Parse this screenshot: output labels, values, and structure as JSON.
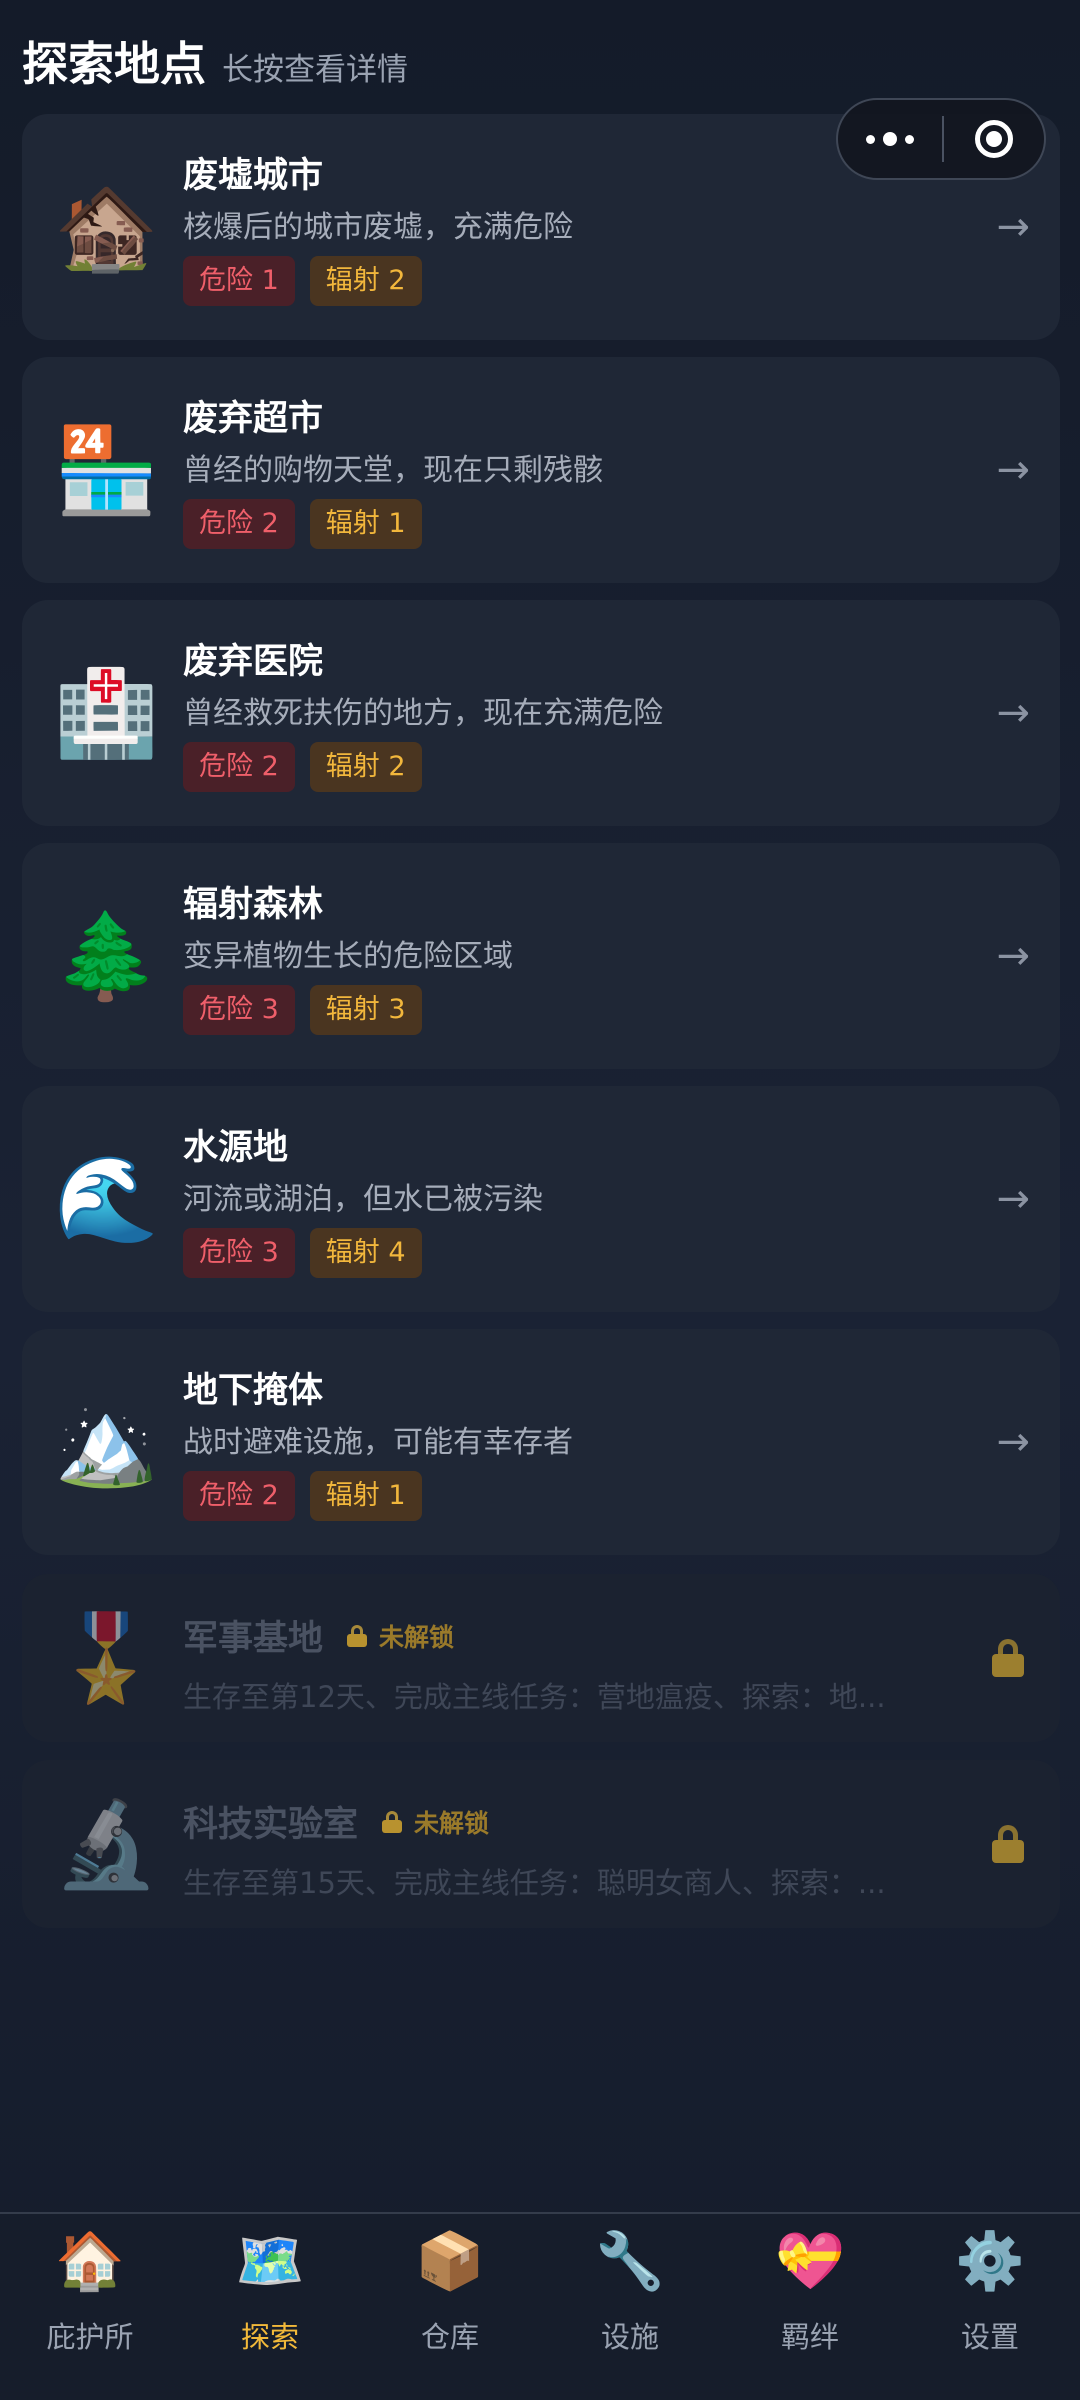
{
  "header": {
    "title": "探索地点",
    "subtitle": "长按查看详情"
  },
  "capsule": {
    "more_icon": "more-dots-icon",
    "close_icon": "target-close-icon"
  },
  "locations": [
    {
      "icon": "🏚️",
      "icon_name": "abandoned-house-icon",
      "title": "废墟城市",
      "desc": "核爆后的城市废墟，充满危险",
      "danger": "危险 1",
      "radiation": "辐射 2"
    },
    {
      "icon": "🏪",
      "icon_name": "convenience-store-icon",
      "title": "废弃超市",
      "desc": "曾经的购物天堂，现在只剩残骸",
      "danger": "危险 2",
      "radiation": "辐射 1"
    },
    {
      "icon": "🏥",
      "icon_name": "hospital-icon",
      "title": "废弃医院",
      "desc": "曾经救死扶伤的地方，现在充满危险",
      "danger": "危险 2",
      "radiation": "辐射 2"
    },
    {
      "icon": "🌲",
      "icon_name": "evergreen-tree-icon",
      "title": "辐射森林",
      "desc": "变异植物生长的危险区域",
      "danger": "危险 3",
      "radiation": "辐射 3"
    },
    {
      "icon": "🌊",
      "icon_name": "water-wave-icon",
      "title": "水源地",
      "desc": "河流或湖泊，但水已被污染",
      "danger": "危险 3",
      "radiation": "辐射 4"
    },
    {
      "icon": "🏔️",
      "icon_name": "snow-mountain-icon",
      "title": "地下掩体",
      "desc": "战时避难设施，可能有幸存者",
      "danger": "危险 2",
      "radiation": "辐射 1"
    }
  ],
  "arrow": "→",
  "locked_locations": [
    {
      "icon": "🎖️",
      "icon_name": "military-medal-icon",
      "title": "军事基地",
      "badge": "未解锁",
      "desc": "生存至第12天、完成主线任务：营地瘟疫、探索：地..."
    },
    {
      "icon": "🔬",
      "icon_name": "microscope-icon",
      "title": "科技实验室",
      "badge": "未解锁",
      "desc": "生存至第15天、完成主线任务：聪明女商人、探索：..."
    }
  ],
  "nav": {
    "items": [
      {
        "icon": "🏠",
        "icon_name": "house-icon",
        "label": "庇护所"
      },
      {
        "icon": "🗺️",
        "icon_name": "map-icon",
        "label": "探索"
      },
      {
        "icon": "📦",
        "icon_name": "package-icon",
        "label": "仓库"
      },
      {
        "icon": "🔧",
        "icon_name": "wrench-icon",
        "label": "设施"
      },
      {
        "icon": "💝",
        "icon_name": "heart-gift-icon",
        "label": "羁绊"
      },
      {
        "icon": "⚙️",
        "icon_name": "gear-icon",
        "label": "设置"
      }
    ],
    "active_index": 1
  },
  "colors": {
    "background": "#151c2b",
    "card": "#1f2736",
    "danger_text": "#ef5f6a",
    "radiation_text": "#f2b73c",
    "active_nav": "#f2b93a"
  }
}
